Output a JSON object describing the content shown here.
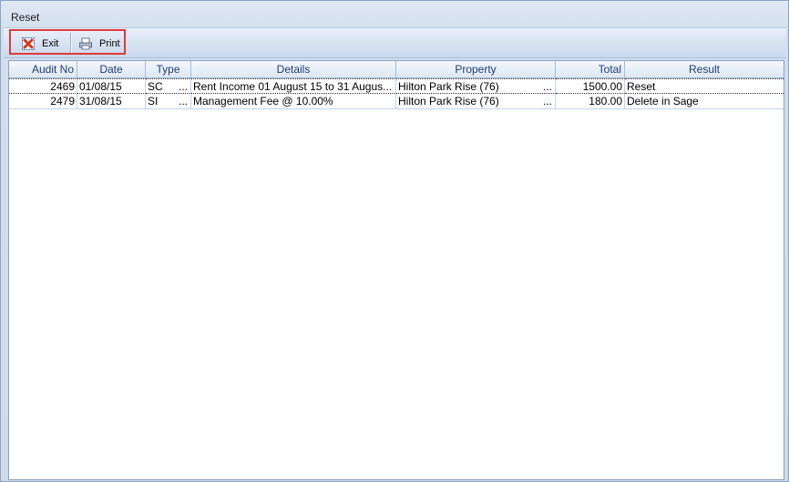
{
  "window": {
    "title": "Reset"
  },
  "toolbar": {
    "exit_label": "Exit",
    "print_label": "Print"
  },
  "grid": {
    "columns": [
      "Audit No",
      "Date",
      "Type",
      "Details",
      "Property",
      "Total",
      "Result"
    ],
    "rows": [
      {
        "audit_no": "2469",
        "date": "01/08/15",
        "type": "SC",
        "details": "Rent Income 01 August 15 to 31 Augus...",
        "property": "Hilton Park Rise (76)",
        "total": "1500.00",
        "result": "Reset"
      },
      {
        "audit_no": "2479",
        "date": "31/08/15",
        "type": "SI",
        "details": "Management Fee @ 10.00%",
        "property": "Hilton Park Rise (76)",
        "total": "180.00",
        "result": "Delete in Sage"
      }
    ],
    "ellipsis": "..."
  }
}
